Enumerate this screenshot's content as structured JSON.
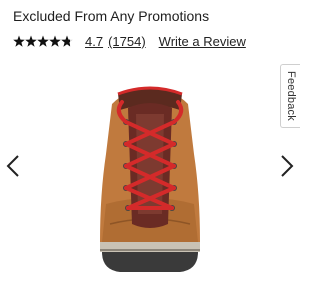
{
  "product": {
    "promo_text": "Excluded From Any Promotions",
    "rating": {
      "stars_filled": 4.7,
      "stars_total": 5,
      "value": "4.7",
      "count_label": "(1754)"
    },
    "write_review_label": "Write a Review"
  },
  "feedback": {
    "label": "Feedback"
  },
  "carousel": {
    "prev_icon": "chevron-left-icon",
    "next_icon": "chevron-right-icon"
  },
  "colors": {
    "boot_leather": "#c07a3e",
    "boot_laces": "#d42a2a",
    "boot_sole": "#3a3a3a"
  }
}
